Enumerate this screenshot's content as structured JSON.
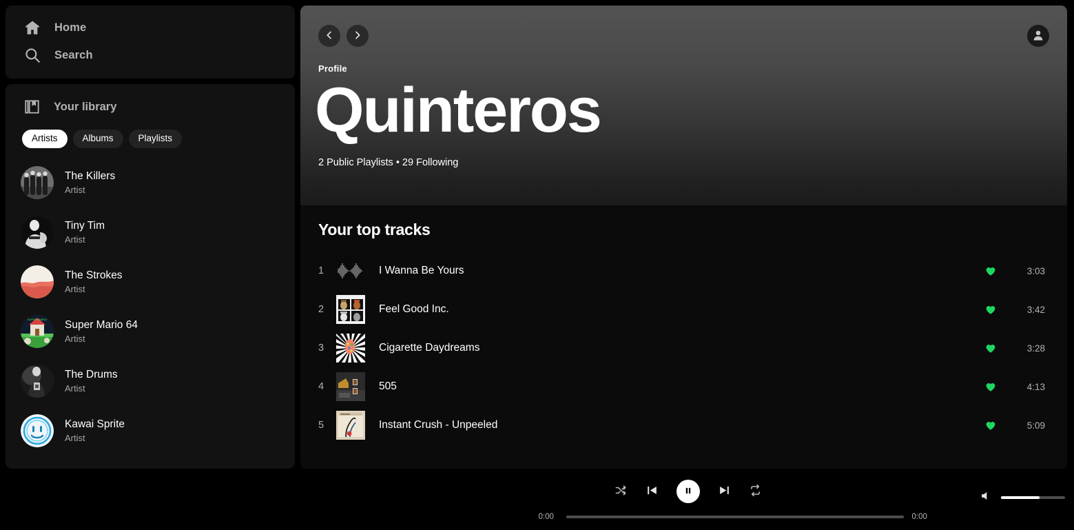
{
  "colors": {
    "accent_green": "#1ed760",
    "panel": "#121212",
    "page_bg": "#000000",
    "text_primary": "#ffffff",
    "text_muted": "#b3b3b3",
    "chip_active_bg": "#ffffff",
    "hero_gradient_top": "#535353",
    "hero_gradient_bottom": "#1b1b1b"
  },
  "sidebar": {
    "nav": [
      {
        "label": "Home",
        "icon": "home-icon"
      },
      {
        "label": "Search",
        "icon": "search-icon"
      }
    ],
    "library": {
      "label": "Your library",
      "icon": "library-icon",
      "chips": [
        {
          "label": "Artists",
          "active": true
        },
        {
          "label": "Albums",
          "active": false
        },
        {
          "label": "Playlists",
          "active": false
        }
      ],
      "items": [
        {
          "name": "The Killers",
          "type": "Artist"
        },
        {
          "name": "Tiny Tim",
          "type": "Artist"
        },
        {
          "name": "The Strokes",
          "type": "Artist"
        },
        {
          "name": "Super Mario 64",
          "type": "Artist"
        },
        {
          "name": "The Drums",
          "type": "Artist"
        },
        {
          "name": "Kawai Sprite",
          "type": "Artist"
        }
      ]
    }
  },
  "main": {
    "topbar": {
      "back_icon": "chevron-left-icon",
      "forward_icon": "chevron-right-icon",
      "account_icon": "user-avatar-icon"
    },
    "hero": {
      "kicker": "Profile",
      "title": "Quinteros",
      "stats": "2 Public Playlists • 29 Following"
    },
    "tracks": {
      "section_title": "Your top tracks",
      "rows": [
        {
          "index": "1",
          "title": "I Wanna Be Yours",
          "liked": true,
          "duration": "3:03"
        },
        {
          "index": "2",
          "title": "Feel Good Inc.",
          "liked": true,
          "duration": "3:42"
        },
        {
          "index": "3",
          "title": "Cigarette Daydreams",
          "liked": true,
          "duration": "3:28"
        },
        {
          "index": "4",
          "title": "505",
          "liked": true,
          "duration": "4:13"
        },
        {
          "index": "5",
          "title": "Instant Crush - Unpeeled",
          "liked": true,
          "duration": "5:09"
        }
      ]
    }
  },
  "player": {
    "shuffle_icon": "shuffle-icon",
    "previous_icon": "skip-previous-icon",
    "play_state_icon": "pause-icon",
    "next_icon": "skip-next-icon",
    "repeat_icon": "repeat-icon",
    "elapsed": "0:00",
    "remaining": "0:00",
    "progress_percent": 0,
    "volume_icon": "volume-icon",
    "volume_percent": 60
  }
}
